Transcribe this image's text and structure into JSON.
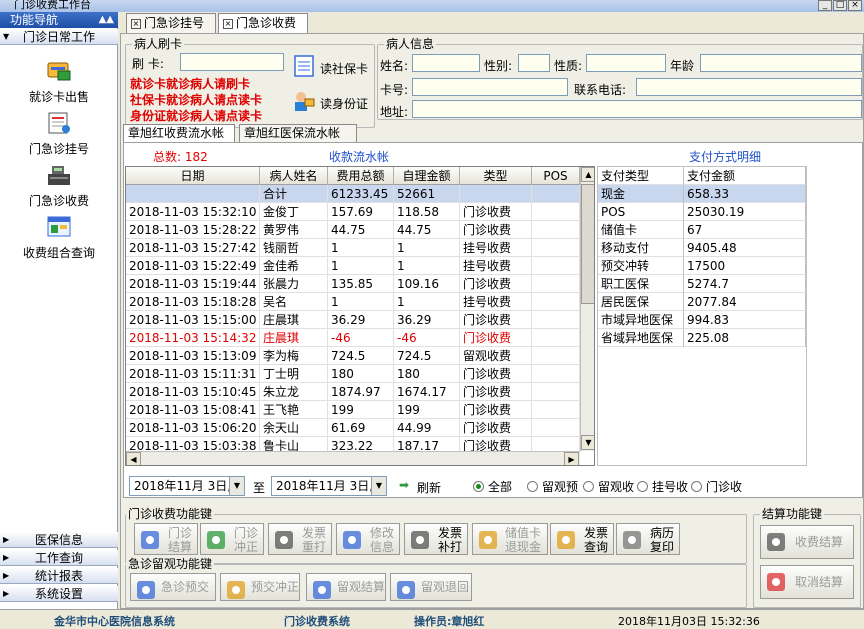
{
  "window": {
    "title": "门诊收费工作台",
    "controls": [
      "_",
      "□",
      "×"
    ]
  },
  "nav": {
    "header": "功能导航",
    "group_top": "门诊日常工作",
    "items": [
      {
        "label": "就诊卡出售",
        "icon": "card-sale-icon"
      },
      {
        "label": "门急诊挂号",
        "icon": "registration-icon"
      },
      {
        "label": "门急诊收费",
        "icon": "cash-register-icon"
      },
      {
        "label": "收费组合查询",
        "icon": "query-icon"
      }
    ],
    "groups": [
      "医保信息",
      "工作查询",
      "统计报表",
      "系统设置"
    ]
  },
  "tabs": [
    {
      "label": "门急诊挂号"
    },
    {
      "label": "门急诊收费"
    }
  ],
  "card": {
    "title": "病人刷卡",
    "swipe_label": "刷  卡:",
    "read_social_btn": "读社保卡",
    "read_id_btn": "读身份证",
    "hints": [
      "就诊卡就诊病人请刷卡",
      "社保卡就诊病人请点读卡",
      "身份证就诊病人请点读卡"
    ]
  },
  "patient": {
    "title": "病人信息",
    "name_label": "姓名:",
    "gender_label": "性别:",
    "nature_label": "性质:",
    "age_label": "年龄",
    "cardno_label": "卡号:",
    "phone_label": "联系电话:",
    "address_label": "地址:"
  },
  "inner_tabs": [
    {
      "label": "章旭红收费流水帐"
    },
    {
      "label": "章旭红医保流水帐"
    }
  ],
  "ledger": {
    "total_label": "总数:",
    "total_count": "182",
    "title": "收款流水帐",
    "headers": [
      "日期",
      "病人姓名",
      "费用总额",
      "自理金额",
      "类型",
      "POS"
    ],
    "sum_row": [
      "",
      "合计",
      "61233.45",
      "52661",
      "",
      ""
    ],
    "rows": [
      [
        "2018-11-03 15:32:10",
        "金俊丁",
        "157.69",
        "118.58",
        "门诊收费",
        ""
      ],
      [
        "2018-11-03 15:28:22",
        "黄罗伟",
        "44.75",
        "44.75",
        "门诊收费",
        ""
      ],
      [
        "2018-11-03 15:27:42",
        "钱丽哲",
        "1",
        "1",
        "挂号收费",
        ""
      ],
      [
        "2018-11-03 15:22:49",
        "金佳希",
        "1",
        "1",
        "挂号收费",
        ""
      ],
      [
        "2018-11-03 15:19:44",
        "张晨力",
        "135.85",
        "109.16",
        "门诊收费",
        ""
      ],
      [
        "2018-11-03 15:18:28",
        "吴名",
        "1",
        "1",
        "挂号收费",
        ""
      ],
      [
        "2018-11-03 15:15:00",
        "庄晨琪",
        "36.29",
        "36.29",
        "门诊收费",
        ""
      ],
      [
        "2018-11-03 15:14:32",
        "庄晨琪",
        "-46",
        "-46",
        "门诊收费",
        ""
      ],
      [
        "2018-11-03 15:13:09",
        "李为梅",
        "724.5",
        "724.5",
        "留观收费",
        ""
      ],
      [
        "2018-11-03 15:11:31",
        "丁士明",
        "180",
        "180",
        "门诊收费",
        ""
      ],
      [
        "2018-11-03 15:10:45",
        "朱立龙",
        "1874.97",
        "1674.17",
        "门诊收费",
        ""
      ],
      [
        "2018-11-03 15:08:41",
        "王飞艳",
        "199",
        "199",
        "门诊收费",
        ""
      ],
      [
        "2018-11-03 15:06:20",
        "余天山",
        "61.69",
        "44.99",
        "门诊收费",
        ""
      ],
      [
        "2018-11-03 15:03:38",
        "鲁卡山",
        "323.22",
        "187.17",
        "门诊收费",
        ""
      ]
    ],
    "highlight_row_index": 7
  },
  "payment": {
    "title": "支付方式明细",
    "headers": [
      "支付类型",
      "支付金额"
    ],
    "rows": [
      [
        "现金",
        "658.33"
      ],
      [
        "POS",
        "25030.19"
      ],
      [
        "储值卡",
        "67"
      ],
      [
        "移动支付",
        "9405.48"
      ],
      [
        "预交冲转",
        "17500"
      ],
      [
        "职工医保",
        "5274.7"
      ],
      [
        "居民医保",
        "2077.84"
      ],
      [
        "市域异地医保",
        "994.83"
      ],
      [
        "省域异地医保",
        "225.08"
      ]
    ]
  },
  "filter": {
    "date_from": "2018年11月 3日,",
    "to_label": "至",
    "date_to": "2018年11月 3日,",
    "refresh_label": "刷新",
    "options": [
      "全部",
      "留观预",
      "留观收",
      "挂号收",
      "门诊收"
    ],
    "selected": "全部"
  },
  "fee_keys": {
    "title": "门诊收费功能键",
    "buttons": [
      {
        "l1": "门诊",
        "l2": "结算",
        "disabled": true
      },
      {
        "l1": "门诊",
        "l2": "冲正",
        "disabled": true
      },
      {
        "l1": "发票",
        "l2": "重打",
        "disabled": true
      },
      {
        "l1": "修改",
        "l2": "信息",
        "disabled": true
      },
      {
        "l1": "发票",
        "l2": "补打",
        "disabled": false
      },
      {
        "l1": "储值卡",
        "l2": "退现金",
        "disabled": true
      },
      {
        "l1": "发票",
        "l2": "查询",
        "disabled": false
      },
      {
        "l1": "病历",
        "l2": "复印",
        "disabled": false
      }
    ]
  },
  "obs_keys": {
    "title": "急诊留观功能键",
    "buttons": [
      {
        "label": "急诊预交",
        "disabled": true
      },
      {
        "label": "预交冲正",
        "disabled": true
      },
      {
        "label": "留观结算",
        "disabled": true
      },
      {
        "label": "留观退回",
        "disabled": true
      }
    ]
  },
  "settle_keys": {
    "title": "结算功能键",
    "buttons": [
      {
        "label": "收费结算",
        "disabled": true
      },
      {
        "label": "取消结算",
        "disabled": true
      }
    ]
  },
  "status": {
    "hospital": "金华市中心医院信息系统",
    "system": "门诊收费系统",
    "operator": "操作员:章旭红",
    "datetime": "2018年11月03日  15:32:36"
  }
}
